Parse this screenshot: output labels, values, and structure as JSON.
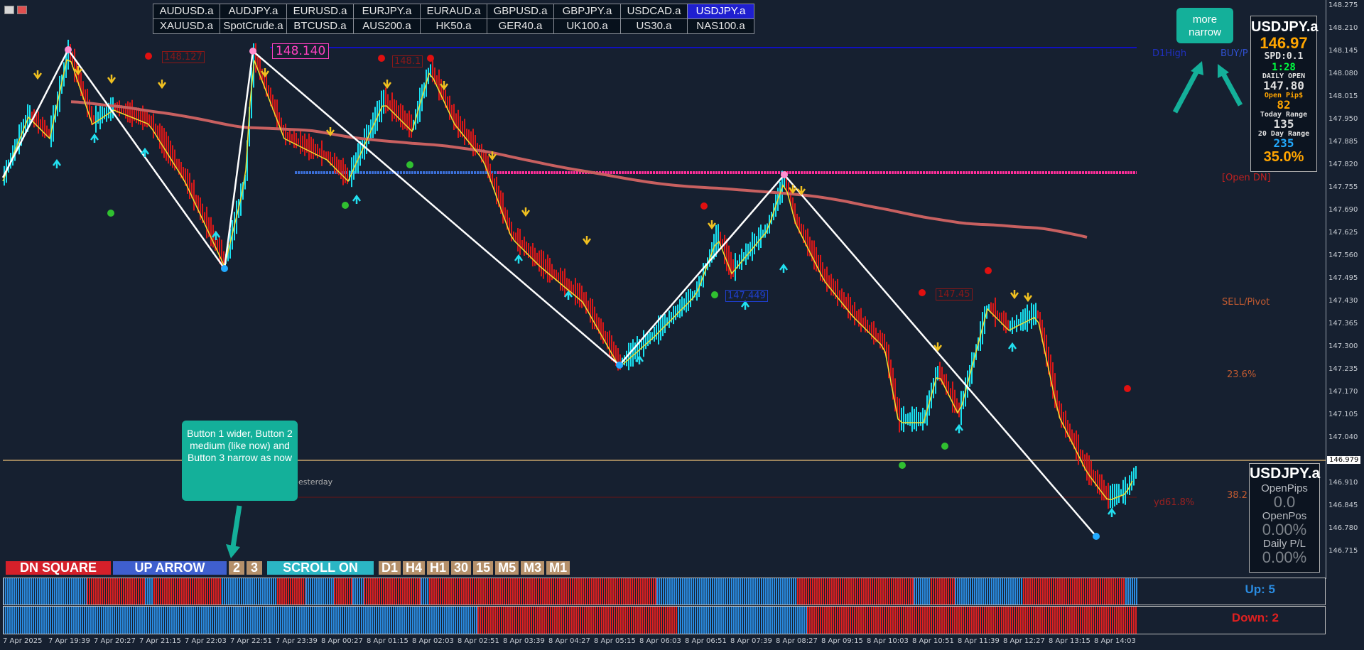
{
  "symbols": [
    [
      "AUDUSD.a",
      "AUDJPY.a",
      "EURUSD.a",
      "EURJPY.a",
      "EURAUD.a",
      "GBPUSD.a",
      "GBPJPY.a",
      "USDCAD.a",
      "USDJPY.a"
    ],
    [
      "XAUUSD.a",
      "SpotCrude.a",
      "BTCUSD.a",
      "AUS200.a",
      "HK50.a",
      "GER40.a",
      "UK100.a",
      "US30.a",
      "NAS100.a"
    ]
  ],
  "active_symbol": "USDJPY.a",
  "price_axis": {
    "labels": [
      "148.275",
      "148.210",
      "148.145",
      "148.080",
      "148.015",
      "147.950",
      "147.885",
      "147.820",
      "147.755",
      "147.690",
      "147.625",
      "147.560",
      "147.495",
      "147.430",
      "147.365",
      "147.300",
      "147.235",
      "147.170",
      "147.105",
      "147.040",
      "146.975",
      "146.910",
      "146.845",
      "146.780",
      "146.715"
    ],
    "current_price": "146.979"
  },
  "time_axis": [
    "7 Apr 2025",
    "7 Apr 19:39",
    "7 Apr 20:27",
    "7 Apr 21:15",
    "7 Apr 22:03",
    "7 Apr 22:51",
    "7 Apr 23:39",
    "8 Apr 00:27",
    "8 Apr 01:15",
    "8 Apr 02:03",
    "8 Apr 02:51",
    "8 Apr 03:39",
    "8 Apr 04:27",
    "8 Apr 05:15",
    "8 Apr 06:03",
    "8 Apr 06:51",
    "8 Apr 07:39",
    "8 Apr 08:27",
    "8 Apr 09:15",
    "8 Apr 10:03",
    "8 Apr 10:51",
    "8 Apr 11:39",
    "8 Apr 12:27",
    "8 Apr 13:15",
    "8 Apr 14:03"
  ],
  "chart_tags": {
    "peak_price": "148.140",
    "tag_a": "148.127",
    "tag_b": "148.1",
    "tag_c": "147.449",
    "tag_d": "147.45",
    "d1high": "D1High",
    "buy_pivot": "BUY/P",
    "open_dn": "[Open DN]",
    "sell_pivot": "SELL/Pivot",
    "fib_236": "23.6%",
    "fib_382": "38.2",
    "yd_618": "yd61.8%",
    "yesterday": "esterday"
  },
  "info_panel": {
    "symbol": "USDJPY.a",
    "price": "146.97",
    "spread": "SPD:0.1",
    "timer": "1:28",
    "daily_open_label": "DAILY OPEN",
    "daily_open": "147.80",
    "open_pips_label": "Open Pip$",
    "open_pips": "82",
    "today_range_label": "Today Range",
    "today_range": "135",
    "day20_label": "20 Day Range",
    "day20": "235",
    "pct": "35.0%"
  },
  "pl_panel": {
    "symbol": "USDJPY.a",
    "open_pips_label": "OpenPips",
    "open_pips": "0.0",
    "open_pos_label": "OpenPos",
    "open_pos": "0.00%",
    "daily_pl_label": "Daily P/L",
    "daily_pl": "0.00%"
  },
  "notes": {
    "top": "more narrow",
    "bottom": "Button 1 wider, Button 2 medium (like now) and Button 3 narrow as now"
  },
  "buttons": {
    "dn_square": "DN SQUARE",
    "up_arrow": "UP ARROW",
    "two": "2",
    "three": "3",
    "scroll": "SCROLL ON",
    "tf": [
      "D1",
      "H4",
      "H1",
      "30",
      "15",
      "M5",
      "M3",
      "M1"
    ]
  },
  "strips": {
    "up_label": "Up: 5",
    "down_label": "Down: 2",
    "up_color": "#2a8be0",
    "down_color": "#e02020"
  },
  "colors": {
    "bull": "#19e0f0",
    "bear": "#d81818",
    "ma_fast": "#f0e030",
    "ma_slow": "#c86060",
    "zigzag": "#ffffff",
    "background": "#162030"
  }
}
